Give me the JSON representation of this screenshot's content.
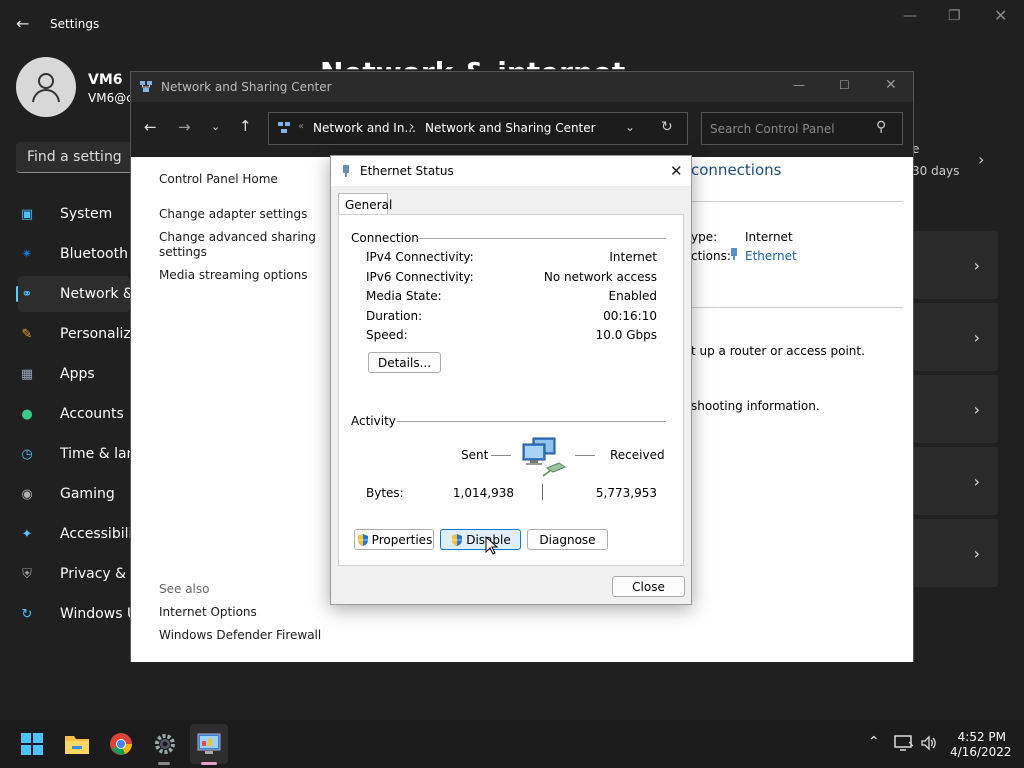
{
  "settings": {
    "title": "Settings",
    "user_name": "VM6",
    "user_email": "VM6@c",
    "search_placeholder": "Find a setting",
    "page_heading": "Network & internet",
    "nav": [
      {
        "label": "System",
        "icon": "monitor-icon",
        "color": "#4cc2ff"
      },
      {
        "label": "Bluetooth &",
        "icon": "bluetooth-icon",
        "color": "#0a84ff"
      },
      {
        "label": "Network &",
        "icon": "wifi-icon",
        "color": "#4cc2ff"
      },
      {
        "label": "Personaliza",
        "icon": "brush-icon",
        "color": "#e8a33c"
      },
      {
        "label": "Apps",
        "icon": "apps-icon",
        "color": "#9aa4b8"
      },
      {
        "label": "Accounts",
        "icon": "person-icon",
        "color": "#3ec98a"
      },
      {
        "label": "Time & lang",
        "icon": "clock-icon",
        "color": "#4cc2ff"
      },
      {
        "label": "Gaming",
        "icon": "gamepad-icon",
        "color": "#b0b0b0"
      },
      {
        "label": "Accessibility",
        "icon": "accessibility-icon",
        "color": "#4cc2ff"
      },
      {
        "label": "Privacy & se",
        "icon": "shield-icon",
        "color": "#a0a0a0"
      },
      {
        "label": "Windows U",
        "icon": "update-icon",
        "color": "#4cc2ff"
      }
    ],
    "right_fragment_e": "e",
    "right_fragment_days": "30 days"
  },
  "control_panel": {
    "title": "Network and Sharing Center",
    "breadcrumb_1": "Network and In...",
    "breadcrumb_sep": "›",
    "breadcrumb_2": "Network and Sharing Center",
    "search_placeholder": "Search Control Panel",
    "left_links": {
      "home": "Control Panel Home",
      "adapter": "Change adapter settings",
      "advanced_1": "Change advanced sharing",
      "advanced_2": "settings",
      "media": "Media streaming options"
    },
    "see_also": "See also",
    "see_also_links": [
      "Internet Options",
      "Windows Defender Firewall"
    ],
    "right_fragments": {
      "connections": "connections",
      "type_label": "ype:",
      "type_value": "Internet",
      "conn_label": "ctions:",
      "conn_value": "Ethernet",
      "router_text": "t up a router or access point.",
      "troubleshoot_text": "shooting information."
    }
  },
  "dialog": {
    "title": "Ethernet Status",
    "tab": "General",
    "connection_label": "Connection",
    "rows": [
      {
        "label": "IPv4 Connectivity:",
        "value": "Internet"
      },
      {
        "label": "IPv6 Connectivity:",
        "value": "No network access"
      },
      {
        "label": "Media State:",
        "value": "Enabled"
      },
      {
        "label": "Duration:",
        "value": "00:16:10"
      },
      {
        "label": "Speed:",
        "value": "10.0 Gbps"
      }
    ],
    "details_button": "Details...",
    "activity_label": "Activity",
    "sent_label": "Sent",
    "received_label": "Received",
    "bytes_label": "Bytes:",
    "bytes_sent": "1,014,938",
    "bytes_received": "5,773,953",
    "properties_button": "Properties",
    "disable_button": "Disable",
    "diagnose_button": "Diagnose",
    "close_button": "Close"
  },
  "taskbar": {
    "time": "4:52 PM",
    "date": "4/16/2022"
  }
}
